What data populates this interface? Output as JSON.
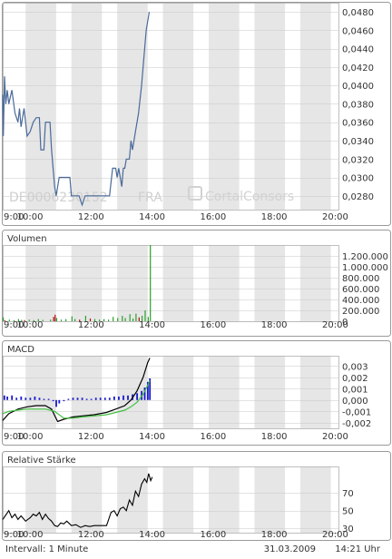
{
  "watermark": {
    "isin": "DE0006230152",
    "exchange": "FRA",
    "brand": "CortalConsors"
  },
  "time_axis": {
    "ticks": [
      {
        "value": 9,
        "label": "9:00"
      },
      {
        "value": 10,
        "label": "10:00"
      },
      {
        "value": 12,
        "label": "12:00"
      },
      {
        "value": 14,
        "label": "14:00"
      },
      {
        "value": 16,
        "label": "16:00"
      },
      {
        "value": 18,
        "label": "18:00"
      },
      {
        "value": 20,
        "label": "20:00"
      }
    ],
    "shaded_bands": [
      [
        9.75,
        10.75
      ],
      [
        11.25,
        12.25
      ],
      [
        12.75,
        13.75
      ],
      [
        14.25,
        15.25
      ],
      [
        15.75,
        16.75
      ],
      [
        17.25,
        18.25
      ],
      [
        18.75,
        19.75
      ]
    ]
  },
  "footer": {
    "interval": "Intervall: 1 Minute",
    "date": "31.03.2009",
    "time": "14:21 Uhr"
  },
  "colors": {
    "price_line": "#4a6a9a",
    "volume_up": "#2aa02a",
    "volume_down": "#b01010",
    "macd_line": "#000000",
    "signal_line": "#40c040",
    "histogram": "#1a1acc",
    "shade": "#e6e6e6",
    "grid": "#c8c8c8"
  },
  "chart_data": [
    {
      "type": "line",
      "name": "price",
      "title": "",
      "xlim": [
        9,
        20
      ],
      "ylim": [
        0.0265,
        0.049
      ],
      "y_ticks": [
        "0,0480",
        "0,0460",
        "0,0440",
        "0,0420",
        "0,0400",
        "0,0380",
        "0,0360",
        "0,0340",
        "0,0320",
        "0,0300",
        "0,0280"
      ],
      "y_tick_values": [
        0.048,
        0.046,
        0.044,
        0.042,
        0.04,
        0.038,
        0.036,
        0.034,
        0.032,
        0.03,
        0.028
      ],
      "grid": true,
      "points": [
        [
          9.0,
          0.039
        ],
        [
          9.02,
          0.0345
        ],
        [
          9.06,
          0.041
        ],
        [
          9.1,
          0.038
        ],
        [
          9.15,
          0.0395
        ],
        [
          9.2,
          0.038
        ],
        [
          9.3,
          0.0395
        ],
        [
          9.4,
          0.037
        ],
        [
          9.5,
          0.036
        ],
        [
          9.55,
          0.0375
        ],
        [
          9.6,
          0.0355
        ],
        [
          9.7,
          0.0375
        ],
        [
          9.75,
          0.036
        ],
        [
          9.8,
          0.0345
        ],
        [
          9.9,
          0.035
        ],
        [
          10.0,
          0.036
        ],
        [
          10.1,
          0.0365
        ],
        [
          10.2,
          0.0365
        ],
        [
          10.25,
          0.033
        ],
        [
          10.35,
          0.033
        ],
        [
          10.4,
          0.036
        ],
        [
          10.55,
          0.036
        ],
        [
          10.6,
          0.033
        ],
        [
          10.65,
          0.031
        ],
        [
          10.7,
          0.029
        ],
        [
          10.75,
          0.028
        ],
        [
          10.85,
          0.03
        ],
        [
          11.0,
          0.03
        ],
        [
          11.2,
          0.03
        ],
        [
          11.25,
          0.028
        ],
        [
          11.5,
          0.028
        ],
        [
          11.6,
          0.027
        ],
        [
          11.7,
          0.028
        ],
        [
          12.0,
          0.028
        ],
        [
          12.3,
          0.028
        ],
        [
          12.5,
          0.028
        ],
        [
          12.6,
          0.031
        ],
        [
          12.7,
          0.031
        ],
        [
          12.75,
          0.03
        ],
        [
          12.8,
          0.031
        ],
        [
          12.85,
          0.03
        ],
        [
          12.9,
          0.029
        ],
        [
          12.95,
          0.031
        ],
        [
          13.0,
          0.031
        ],
        [
          13.05,
          0.032
        ],
        [
          13.15,
          0.032
        ],
        [
          13.2,
          0.034
        ],
        [
          13.25,
          0.033
        ],
        [
          13.35,
          0.035
        ],
        [
          13.45,
          0.037
        ],
        [
          13.55,
          0.04
        ],
        [
          13.6,
          0.042
        ],
        [
          13.65,
          0.044
        ],
        [
          13.7,
          0.046
        ],
        [
          13.75,
          0.047
        ],
        [
          13.8,
          0.048
        ]
      ]
    },
    {
      "type": "bar",
      "name": "volume",
      "title": "Volumen",
      "xlim": [
        9,
        20
      ],
      "ylim": [
        0,
        1400000
      ],
      "y_ticks": [
        "1.200.000",
        "1.000.000",
        "800.000",
        "600.000",
        "400.000",
        "200.000",
        "0"
      ],
      "y_tick_values": [
        1200000,
        1000000,
        800000,
        600000,
        400000,
        200000,
        0
      ],
      "grid": true,
      "bars": [
        [
          9.0,
          70000,
          "up"
        ],
        [
          9.05,
          20000,
          "down"
        ],
        [
          9.2,
          30000,
          "up"
        ],
        [
          9.35,
          20000,
          "up"
        ],
        [
          9.5,
          40000,
          "up"
        ],
        [
          9.6,
          25000,
          "up"
        ],
        [
          9.7,
          20000,
          "down"
        ],
        [
          9.85,
          30000,
          "up"
        ],
        [
          10.0,
          20000,
          "up"
        ],
        [
          10.15,
          40000,
          "up"
        ],
        [
          10.3,
          25000,
          "up"
        ],
        [
          10.55,
          30000,
          "up"
        ],
        [
          10.65,
          80000,
          "down"
        ],
        [
          10.7,
          120000,
          "down"
        ],
        [
          10.75,
          60000,
          "up"
        ],
        [
          10.9,
          30000,
          "up"
        ],
        [
          11.05,
          40000,
          "up"
        ],
        [
          11.25,
          90000,
          "up"
        ],
        [
          11.35,
          40000,
          "up"
        ],
        [
          11.5,
          30000,
          "down"
        ],
        [
          11.7,
          100000,
          "up"
        ],
        [
          11.85,
          50000,
          "down"
        ],
        [
          12.0,
          40000,
          "up"
        ],
        [
          12.15,
          30000,
          "up"
        ],
        [
          12.3,
          40000,
          "up"
        ],
        [
          12.45,
          30000,
          "up"
        ],
        [
          12.6,
          80000,
          "up"
        ],
        [
          12.75,
          60000,
          "up"
        ],
        [
          12.9,
          100000,
          "up"
        ],
        [
          13.0,
          60000,
          "up"
        ],
        [
          13.15,
          130000,
          "up"
        ],
        [
          13.25,
          50000,
          "up"
        ],
        [
          13.35,
          140000,
          "up"
        ],
        [
          13.45,
          70000,
          "down"
        ],
        [
          13.55,
          100000,
          "up"
        ],
        [
          13.65,
          200000,
          "up"
        ],
        [
          13.75,
          80000,
          "up"
        ],
        [
          13.82,
          1400000,
          "up"
        ]
      ]
    },
    {
      "type": "line",
      "name": "macd",
      "title": "MACD",
      "xlim": [
        9,
        20
      ],
      "ylim": [
        -0.0025,
        0.0039
      ],
      "y_ticks": [
        "0,003",
        "0,002",
        "0,001",
        "0,000",
        "-0,001",
        "-0,002"
      ],
      "y_tick_values": [
        0.003,
        0.002,
        0.001,
        0.0,
        -0.001,
        -0.002
      ],
      "grid": true,
      "series": [
        {
          "role": "macd",
          "points": [
            [
              9.0,
              -0.0018
            ],
            [
              9.2,
              -0.0012
            ],
            [
              9.5,
              -0.0008
            ],
            [
              9.8,
              -0.0006
            ],
            [
              10.1,
              -0.0005
            ],
            [
              10.4,
              -0.0005
            ],
            [
              10.6,
              -0.0008
            ],
            [
              10.8,
              -0.0019
            ],
            [
              11.0,
              -0.0017
            ],
            [
              11.3,
              -0.0015
            ],
            [
              11.6,
              -0.0014
            ],
            [
              12.0,
              -0.0013
            ],
            [
              12.4,
              -0.0011
            ],
            [
              12.7,
              -0.0008
            ],
            [
              13.0,
              -0.0005
            ],
            [
              13.2,
              0.0
            ],
            [
              13.4,
              0.0008
            ],
            [
              13.6,
              0.002
            ],
            [
              13.75,
              0.0033
            ],
            [
              13.82,
              0.0037
            ]
          ]
        },
        {
          "role": "signal",
          "points": [
            [
              9.0,
              -0.0012
            ],
            [
              9.2,
              -0.001
            ],
            [
              9.5,
              -0.0009
            ],
            [
              9.8,
              -0.0008
            ],
            [
              10.1,
              -0.0008
            ],
            [
              10.4,
              -0.0008
            ],
            [
              10.7,
              -0.001
            ],
            [
              11.0,
              -0.0016
            ],
            [
              11.3,
              -0.0016
            ],
            [
              11.6,
              -0.0015
            ],
            [
              12.0,
              -0.0014
            ],
            [
              12.4,
              -0.0013
            ],
            [
              12.7,
              -0.0011
            ],
            [
              13.0,
              -0.0009
            ],
            [
              13.2,
              -0.0006
            ],
            [
              13.4,
              -0.0002
            ],
            [
              13.6,
              0.0005
            ],
            [
              13.75,
              0.0013
            ],
            [
              13.82,
              0.0017
            ]
          ]
        }
      ],
      "histogram": [
        [
          9.05,
          0.0004
        ],
        [
          9.15,
          0.0003
        ],
        [
          9.3,
          0.0004
        ],
        [
          9.45,
          0.0002
        ],
        [
          9.6,
          0.0003
        ],
        [
          9.75,
          0.0002
        ],
        [
          9.9,
          0.0002
        ],
        [
          10.05,
          0.0003
        ],
        [
          10.2,
          0.0002
        ],
        [
          10.35,
          0.0001
        ],
        [
          10.5,
          0.0001
        ],
        [
          10.65,
          -0.0001
        ],
        [
          10.75,
          -0.0006
        ],
        [
          10.85,
          -0.0003
        ],
        [
          11.0,
          -0.0001
        ],
        [
          11.15,
          0.0001
        ],
        [
          11.3,
          0.0002
        ],
        [
          11.45,
          0.0002
        ],
        [
          11.6,
          0.0002
        ],
        [
          11.75,
          0.0001
        ],
        [
          11.9,
          0.0001
        ],
        [
          12.05,
          0.0002
        ],
        [
          12.2,
          0.0002
        ],
        [
          12.35,
          0.0002
        ],
        [
          12.5,
          0.0002
        ],
        [
          12.65,
          0.0003
        ],
        [
          12.8,
          0.0003
        ],
        [
          12.95,
          0.0004
        ],
        [
          13.1,
          0.0004
        ],
        [
          13.25,
          0.0005
        ],
        [
          13.4,
          0.0006
        ],
        [
          13.55,
          0.0008
        ],
        [
          13.65,
          0.0011
        ],
        [
          13.75,
          0.0016
        ],
        [
          13.82,
          0.0019
        ]
      ]
    },
    {
      "type": "line",
      "name": "rsi",
      "title": "Relative Stärke",
      "xlim": [
        9,
        20
      ],
      "ylim": [
        25,
        100
      ],
      "y_ticks": [
        "70",
        "50",
        "30"
      ],
      "y_tick_values": [
        70,
        50,
        30
      ],
      "grid": true,
      "points": [
        [
          9.0,
          40
        ],
        [
          9.1,
          45
        ],
        [
          9.2,
          50
        ],
        [
          9.3,
          42
        ],
        [
          9.4,
          46
        ],
        [
          9.5,
          40
        ],
        [
          9.6,
          44
        ],
        [
          9.75,
          38
        ],
        [
          9.9,
          42
        ],
        [
          10.0,
          46
        ],
        [
          10.1,
          44
        ],
        [
          10.2,
          48
        ],
        [
          10.3,
          40
        ],
        [
          10.4,
          46
        ],
        [
          10.5,
          41
        ],
        [
          10.6,
          38
        ],
        [
          10.7,
          33
        ],
        [
          10.8,
          32
        ],
        [
          10.9,
          36
        ],
        [
          11.0,
          35
        ],
        [
          11.1,
          38
        ],
        [
          11.25,
          33
        ],
        [
          11.4,
          34
        ],
        [
          11.55,
          31
        ],
        [
          11.7,
          33
        ],
        [
          11.85,
          32
        ],
        [
          12.0,
          33
        ],
        [
          12.2,
          33
        ],
        [
          12.4,
          33
        ],
        [
          12.55,
          48
        ],
        [
          12.65,
          50
        ],
        [
          12.75,
          44
        ],
        [
          12.85,
          52
        ],
        [
          12.95,
          54
        ],
        [
          13.05,
          50
        ],
        [
          13.15,
          62
        ],
        [
          13.25,
          56
        ],
        [
          13.35,
          72
        ],
        [
          13.45,
          66
        ],
        [
          13.55,
          80
        ],
        [
          13.65,
          86
        ],
        [
          13.72,
          82
        ],
        [
          13.78,
          92
        ],
        [
          13.85,
          84
        ],
        [
          13.9,
          88
        ]
      ]
    }
  ]
}
